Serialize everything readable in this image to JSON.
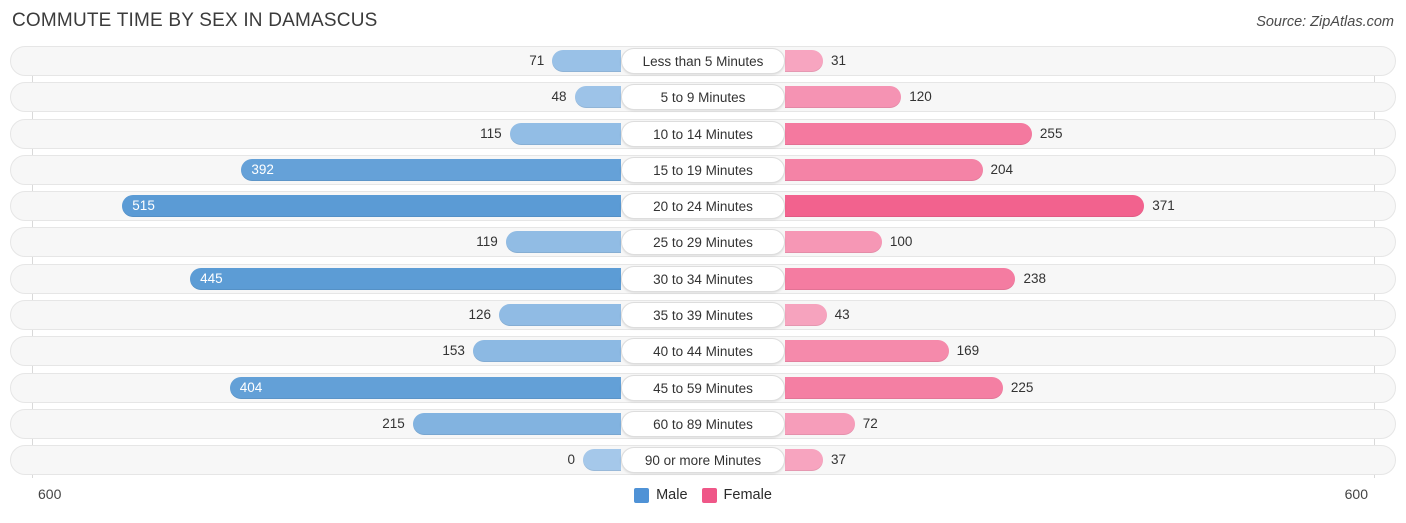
{
  "header": {
    "title": "COMMUTE TIME BY SEX IN DAMASCUS",
    "source": "Source: ZipAtlas.com"
  },
  "axis": {
    "left_end_label": "600",
    "right_end_label": "600",
    "max": 600
  },
  "legend": [
    {
      "label": "Male",
      "color": "#4f92d6"
    },
    {
      "label": "Female",
      "color": "#ef5788"
    }
  ],
  "colors": {
    "male_light": "#a5c8ea",
    "male_dark": "#5b9bd5",
    "female_light": "#f7abc4",
    "female_dark": "#f2628e",
    "track": "#f7f7f7",
    "track_border": "#e6e6e6"
  },
  "chart_data": {
    "type": "bar",
    "title": "COMMUTE TIME BY SEX IN DAMASCUS",
    "subtitle": "Source: ZipAtlas.com",
    "orientation": "horizontal-diverging",
    "xlabel": "",
    "ylabel": "",
    "xlim": [
      600,
      600
    ],
    "grid": false,
    "legend_position": "bottom-center",
    "categories": [
      "Less than 5 Minutes",
      "5 to 9 Minutes",
      "10 to 14 Minutes",
      "15 to 19 Minutes",
      "20 to 24 Minutes",
      "25 to 29 Minutes",
      "30 to 34 Minutes",
      "35 to 39 Minutes",
      "40 to 44 Minutes",
      "45 to 59 Minutes",
      "60 to 89 Minutes",
      "90 or more Minutes"
    ],
    "series": [
      {
        "name": "Male",
        "values": [
          71,
          48,
          115,
          392,
          515,
          119,
          445,
          126,
          153,
          404,
          215,
          0
        ]
      },
      {
        "name": "Female",
        "values": [
          31,
          120,
          255,
          204,
          371,
          100,
          238,
          43,
          169,
          225,
          72,
          37
        ]
      }
    ]
  }
}
